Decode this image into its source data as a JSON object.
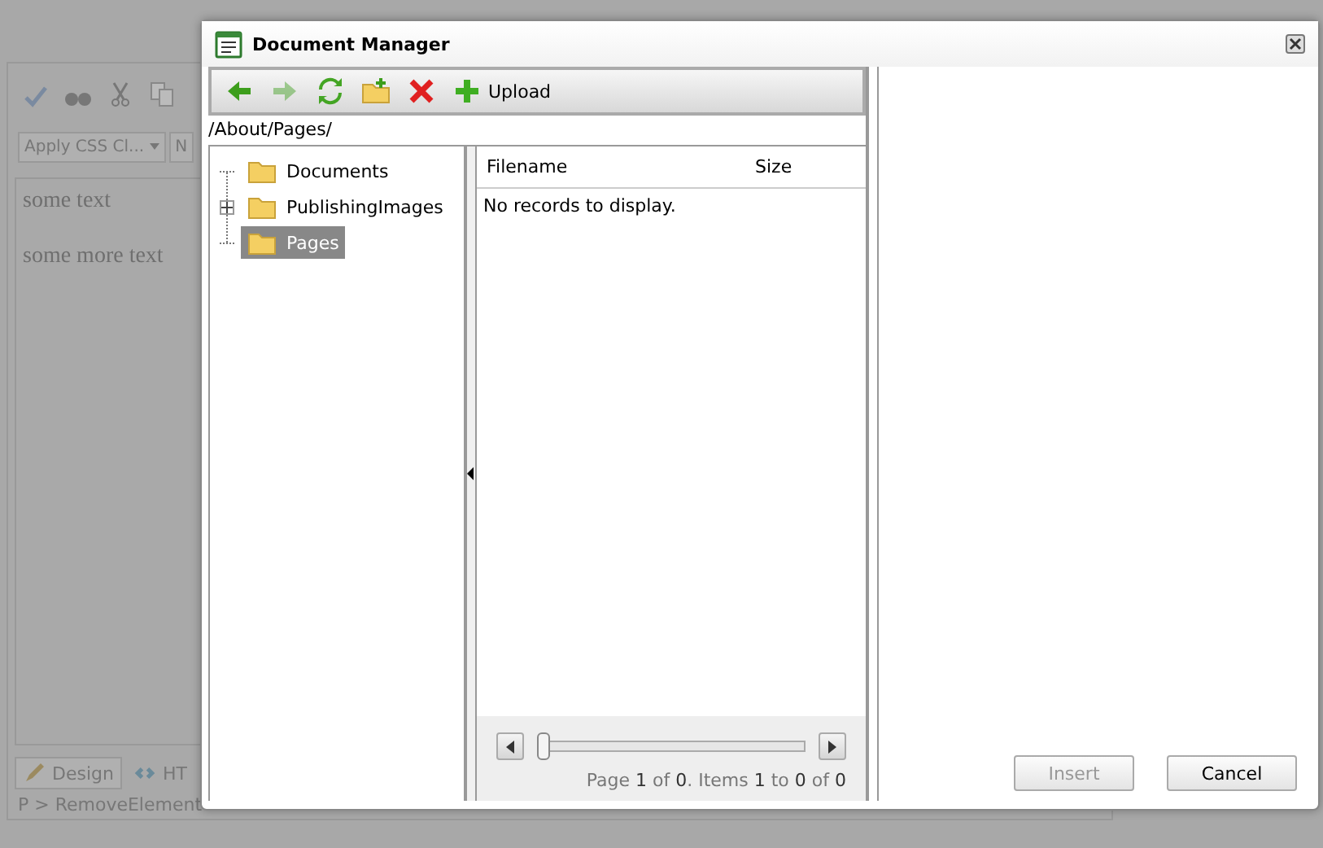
{
  "editor": {
    "css_dropdown": "Apply CSS Cl...",
    "cut_dropdown": "N",
    "content": [
      "some text",
      "some more text"
    ],
    "mode_tabs": [
      {
        "label": "Design",
        "selected": true
      },
      {
        "label": "HT",
        "selected": false
      }
    ],
    "status_bar": "P > RemoveElement"
  },
  "dialog": {
    "title": "Document Manager",
    "toolbar": [
      {
        "kind": "back",
        "disabled": false
      },
      {
        "kind": "forward",
        "disabled": true
      },
      {
        "kind": "refresh",
        "disabled": false
      },
      {
        "kind": "new-folder",
        "disabled": false
      },
      {
        "kind": "delete",
        "disabled": false
      },
      {
        "kind": "upload",
        "label": "Upload",
        "disabled": false
      }
    ],
    "path": "/About/Pages/",
    "tree": [
      {
        "label": "Documents",
        "has_children": false,
        "selected": false
      },
      {
        "label": "PublishingImages",
        "has_children": true,
        "selected": false
      },
      {
        "label": "Pages",
        "has_children": false,
        "selected": true
      }
    ],
    "grid": {
      "columns": [
        "Filename",
        "Size"
      ],
      "empty_message": "No records to display.",
      "pager": {
        "level": 0,
        "info": "Page **1** of **0**. Items **1** to **0** of **0**"
      }
    },
    "buttons": [
      {
        "label": "Insert",
        "disabled": true
      },
      {
        "label": "Cancel",
        "disabled": false
      }
    ]
  }
}
